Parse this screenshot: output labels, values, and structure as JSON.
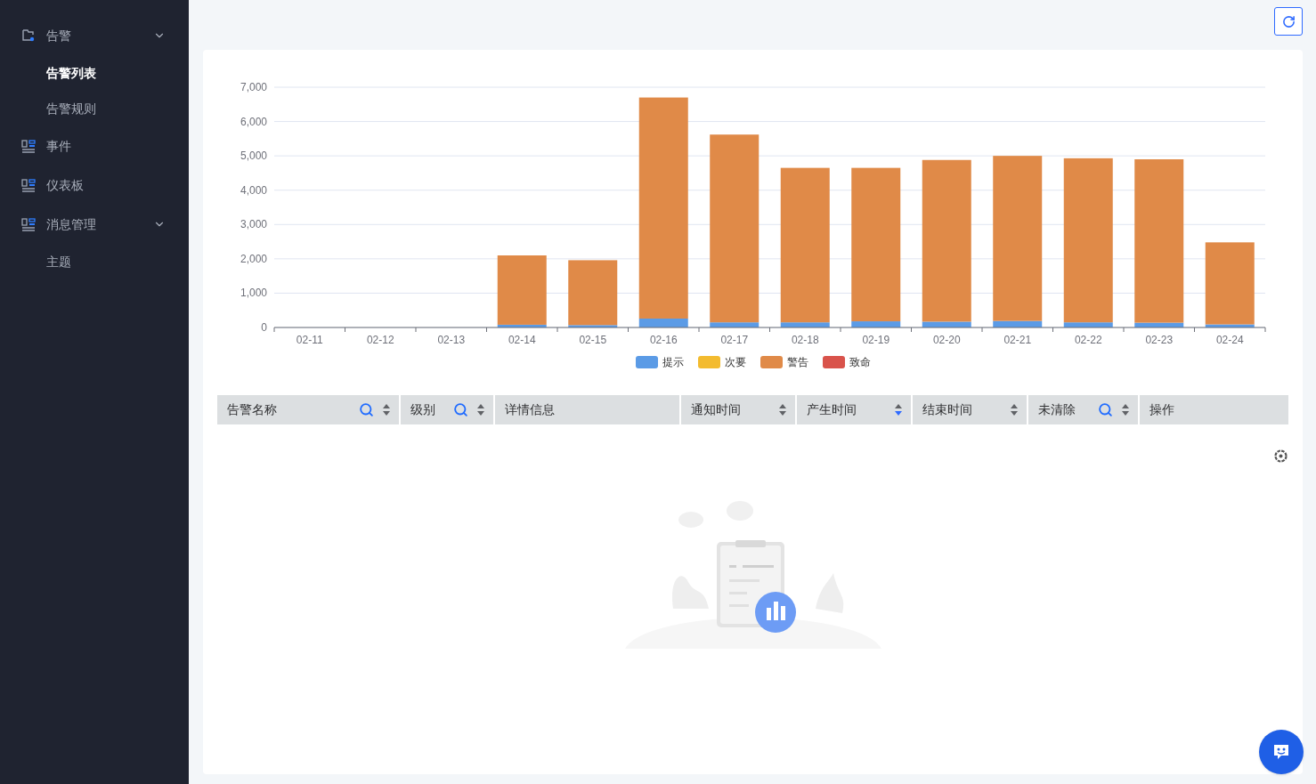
{
  "sidebar": {
    "items": [
      {
        "label": "告警",
        "kind": "folder",
        "expanded": true,
        "children": [
          {
            "label": "告警列表",
            "selected": true
          },
          {
            "label": "告警规则",
            "selected": false
          }
        ]
      },
      {
        "label": "事件",
        "kind": "panel"
      },
      {
        "label": "仪表板",
        "kind": "panel"
      },
      {
        "label": "消息管理",
        "kind": "panel",
        "expanded": true,
        "children": [
          {
            "label": "主题",
            "selected": false
          }
        ]
      }
    ]
  },
  "chart_data": {
    "type": "bar",
    "stacked": true,
    "grid": true,
    "categories": [
      "02-11",
      "02-12",
      "02-13",
      "02-14",
      "02-15",
      "02-16",
      "02-17",
      "02-18",
      "02-19",
      "02-20",
      "02-21",
      "02-22",
      "02-23",
      "02-24"
    ],
    "series": [
      {
        "name": "提示",
        "color": "#5b9be6",
        "values": [
          0,
          0,
          0,
          80,
          70,
          260,
          150,
          150,
          180,
          170,
          190,
          150,
          140,
          90
        ]
      },
      {
        "name": "次要",
        "color": "#f3bb2f",
        "values": [
          0,
          0,
          0,
          0,
          0,
          0,
          0,
          0,
          0,
          0,
          0,
          0,
          0,
          0
        ]
      },
      {
        "name": "警告",
        "color": "#e08a48",
        "values": [
          0,
          0,
          0,
          2020,
          1890,
          6440,
          5470,
          4500,
          4470,
          4710,
          4810,
          4780,
          4760,
          2390
        ]
      },
      {
        "name": "致命",
        "color": "#d9534b",
        "values": [
          0,
          0,
          0,
          0,
          0,
          0,
          0,
          0,
          0,
          0,
          0,
          0,
          0,
          0
        ]
      }
    ],
    "ylim": [
      0,
      7000
    ],
    "yticks": [
      {
        "value": 0,
        "label": "0"
      },
      {
        "value": 1000,
        "label": "1,000"
      },
      {
        "value": 2000,
        "label": "2,000"
      },
      {
        "value": 3000,
        "label": "3,000"
      },
      {
        "value": 4000,
        "label": "4,000"
      },
      {
        "value": 5000,
        "label": "5,000"
      },
      {
        "value": 6000,
        "label": "6,000"
      },
      {
        "value": 7000,
        "label": "7,000"
      }
    ]
  },
  "table": {
    "columns": [
      {
        "label": "告警名称",
        "searchable": true,
        "sortable": true,
        "sorted_descending": false
      },
      {
        "label": "级别",
        "searchable": true,
        "sortable": true,
        "sorted_descending": false
      },
      {
        "label": "详情信息",
        "searchable": false,
        "sortable": false
      },
      {
        "label": "通知时间",
        "searchable": false,
        "sortable": true,
        "sorted_descending": false
      },
      {
        "label": "产生时间",
        "searchable": false,
        "sortable": true,
        "sorted_descending": true
      },
      {
        "label": "结束时间",
        "searchable": false,
        "sortable": true,
        "sorted_descending": false
      },
      {
        "label": "未清除",
        "searchable": true,
        "sortable": true,
        "sorted_descending": false
      },
      {
        "label": "操作",
        "searchable": false,
        "sortable": false
      }
    ]
  }
}
